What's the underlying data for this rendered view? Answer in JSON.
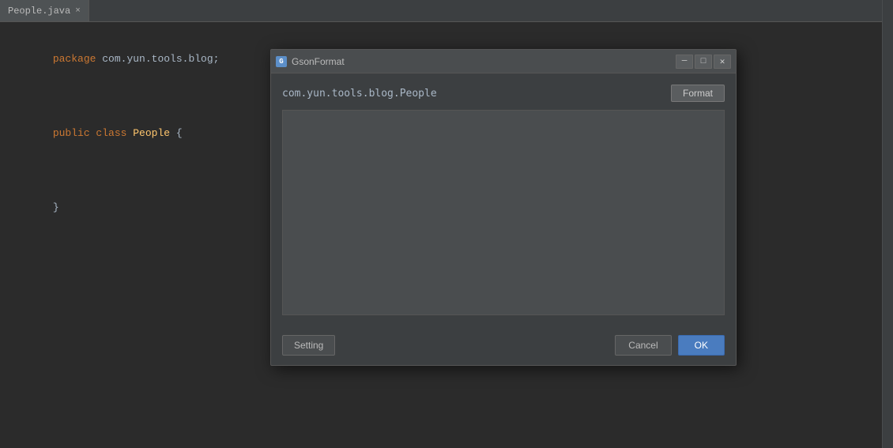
{
  "tab": {
    "filename": "People.java",
    "close_label": "×"
  },
  "editor": {
    "lines": [
      {
        "tokens": [
          {
            "type": "pkg",
            "text": "package "
          },
          {
            "type": "normal",
            "text": "com.yun.tools.blog;"
          },
          {
            "type": "",
            "text": ""
          }
        ]
      },
      {
        "tokens": []
      },
      {
        "tokens": [
          {
            "type": "kw",
            "text": "public "
          },
          {
            "type": "kw",
            "text": "class "
          },
          {
            "type": "cls",
            "text": "People"
          },
          {
            "type": "brace",
            "text": " {"
          }
        ]
      },
      {
        "tokens": []
      },
      {
        "tokens": [
          {
            "type": "brace",
            "text": "}"
          }
        ]
      }
    ]
  },
  "dialog": {
    "title": "GsonFormat",
    "icon_label": "G",
    "minimize_label": "─",
    "maximize_label": "□",
    "close_label": "✕",
    "class_name": "com.yun.tools.blog.People",
    "format_button": "Format",
    "textarea_placeholder": "",
    "textarea_value": "",
    "setting_button": "Setting",
    "cancel_button": "Cancel",
    "ok_button": "OK"
  },
  "colors": {
    "accent_blue": "#4a7cbf",
    "editor_bg": "#2b2b2b",
    "dialog_bg": "#3c3f41"
  }
}
